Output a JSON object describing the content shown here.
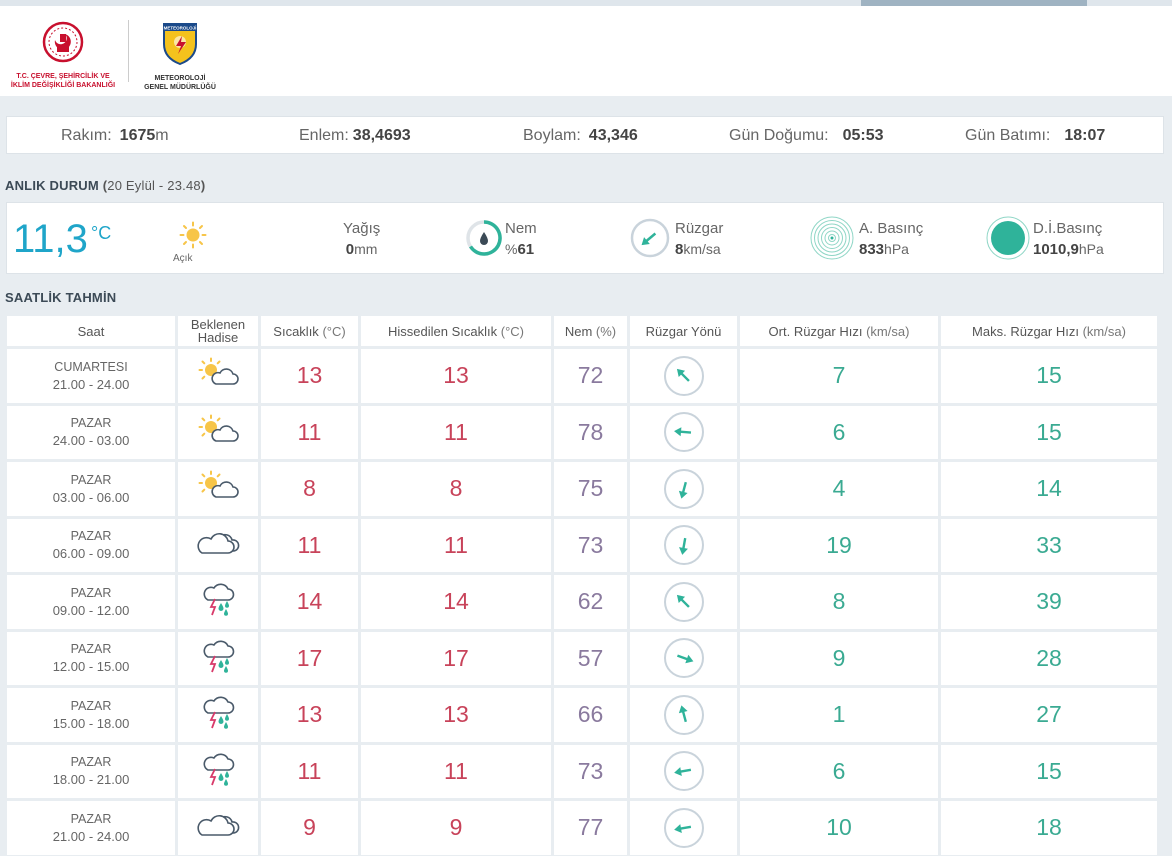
{
  "logos": {
    "ministry_line1": "T.C. ÇEVRE, ŞEHİRCİLİK VE",
    "ministry_line2": "İKLİM DEĞİŞİKLİĞİ BAKANLIĞI",
    "mgm_badge": "METEOROLOJİ",
    "mgm_line1": "METEOROLOJİ",
    "mgm_line2": "GENEL MÜDÜRLÜĞÜ"
  },
  "location_info": {
    "rakim_label": "Rakım:",
    "rakim_value": "1675",
    "rakim_unit": "m",
    "enlem_label": "Enlem:",
    "enlem_value": "38,4693",
    "boylam_label": "Boylam:",
    "boylam_value": "43,346",
    "gun_dogumu_label": "Gün Doğumu:",
    "gun_dogumu_value": "05:53",
    "gun_batimi_label": "Gün Batımı:",
    "gun_batimi_value": "18:07"
  },
  "current": {
    "section_title": "ANLIK DURUM",
    "timestamp": "20 Eylül - 23.48",
    "temperature": "11,3",
    "temperature_unit": "°C",
    "condition": "Açık",
    "condition_icon": "sun-icon",
    "yagis_label": "Yağış",
    "yagis_value": "0",
    "yagis_unit": "mm",
    "nem_label": "Nem",
    "nem_value": "61",
    "nem_prefix": "%",
    "ruzgar_label": "Rüzgar",
    "ruzgar_value": "8",
    "ruzgar_unit": "km/sa",
    "abasinc_label": "A. Basınç",
    "abasinc_value": "833",
    "abasinc_unit": "hPa",
    "dibasinc_label": "D.İ.Basınç",
    "dibasinc_value": "1010,9",
    "dibasinc_unit": "hPa"
  },
  "hourly": {
    "section_title": "SAATLİK TAHMİN",
    "headers": {
      "saat": "Saat",
      "hadise_1": "Beklenen",
      "hadise_2": "Hadise",
      "sicaklik": "Sıcaklık",
      "sicaklik_unit": "(°C)",
      "hissedilen": "Hissedilen Sıcaklık",
      "hissedilen_unit": "(°C)",
      "nem": "Nem",
      "nem_unit": "(%)",
      "ruzgar_yonu": "Rüzgar Yönü",
      "ort_ruzgar": "Ort. Rüzgar Hızı",
      "ort_ruzgar_unit": "(km/sa)",
      "maks_ruzgar": "Maks. Rüzgar Hızı",
      "maks_ruzgar_unit": "(km/sa)"
    },
    "rows": [
      {
        "day": "Cumartesi",
        "time": "21.00 - 24.00",
        "icon": "partly-cloudy-icon",
        "temp": "13",
        "feels": "13",
        "nem": "72",
        "wind_dir_deg": 135,
        "avg_wind": "7",
        "max_wind": "15"
      },
      {
        "day": "Pazar",
        "time": "24.00 - 03.00",
        "icon": "partly-cloudy-icon",
        "temp": "11",
        "feels": "11",
        "nem": "78",
        "wind_dir_deg": 95,
        "avg_wind": "6",
        "max_wind": "15"
      },
      {
        "day": "Pazar",
        "time": "03.00 - 06.00",
        "icon": "partly-cloudy-icon",
        "temp": "8",
        "feels": "8",
        "nem": "75",
        "wind_dir_deg": 15,
        "avg_wind": "4",
        "max_wind": "14"
      },
      {
        "day": "Pazar",
        "time": "06.00 - 09.00",
        "icon": "cloudy-icon",
        "temp": "11",
        "feels": "11",
        "nem": "73",
        "wind_dir_deg": 10,
        "avg_wind": "19",
        "max_wind": "33"
      },
      {
        "day": "Pazar",
        "time": "09.00 - 12.00",
        "icon": "thunderstorm-icon",
        "temp": "14",
        "feels": "14",
        "nem": "62",
        "wind_dir_deg": 135,
        "avg_wind": "8",
        "max_wind": "39"
      },
      {
        "day": "Pazar",
        "time": "12.00 - 15.00",
        "icon": "thunderstorm-icon",
        "temp": "17",
        "feels": "17",
        "nem": "57",
        "wind_dir_deg": 290,
        "avg_wind": "9",
        "max_wind": "28"
      },
      {
        "day": "Pazar",
        "time": "15.00 - 18.00",
        "icon": "thunderstorm-icon",
        "temp": "13",
        "feels": "13",
        "nem": "66",
        "wind_dir_deg": 165,
        "avg_wind": "1",
        "max_wind": "27"
      },
      {
        "day": "Pazar",
        "time": "18.00 - 21.00",
        "icon": "thunderstorm-icon",
        "temp": "11",
        "feels": "11",
        "nem": "73",
        "wind_dir_deg": 80,
        "avg_wind": "6",
        "max_wind": "15"
      },
      {
        "day": "Pazar",
        "time": "21.00 - 24.00",
        "icon": "cloudy-icon",
        "temp": "9",
        "feels": "9",
        "nem": "77",
        "wind_dir_deg": 80,
        "avg_wind": "10",
        "max_wind": "18"
      }
    ]
  },
  "colors": {
    "temp": "#c8435a",
    "humidity": "#8a7a9e",
    "wind": "#3aaa92",
    "current_temp": "#1fa5c9",
    "accent_teal": "#2fb39a"
  }
}
